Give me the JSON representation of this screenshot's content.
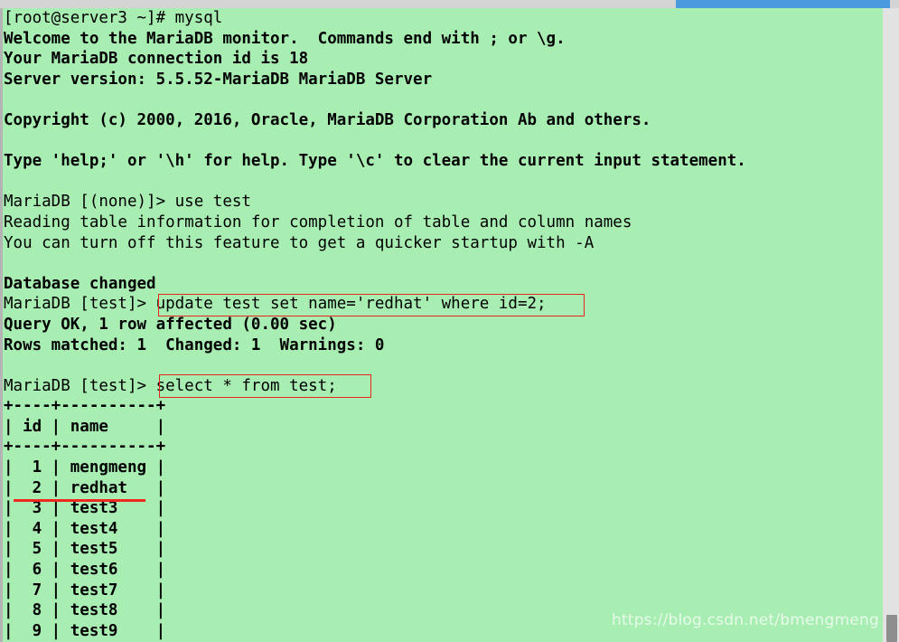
{
  "window": {
    "title": "MariaDB monitor session",
    "background_color": "#a8eeb2",
    "text_color": "#000000",
    "annotation_color": "#e8241b"
  },
  "scrollbars": {
    "horizontal": {
      "name": "horizontal-scrollbar",
      "track_color": "#d4d4d4",
      "thumb_color": "#4a9ade"
    },
    "vertical": {
      "name": "vertical-scrollbar",
      "track_color": "#e2e2e2",
      "thumb_color": "#8d8d8d"
    }
  },
  "terminal": {
    "lines": [
      {
        "text": "[root@server3 ~]# mysql",
        "weight": "reg"
      },
      {
        "text": "Welcome to the MariaDB monitor.  Commands end with ; or \\g.",
        "weight": "bold"
      },
      {
        "text": "Your MariaDB connection id is 18",
        "weight": "bold"
      },
      {
        "text": "Server version: 5.5.52-MariaDB MariaDB Server",
        "weight": "bold"
      },
      {
        "text": "",
        "weight": "blank"
      },
      {
        "text": "Copyright (c) 2000, 2016, Oracle, MariaDB Corporation Ab and others.",
        "weight": "bold"
      },
      {
        "text": "",
        "weight": "blank"
      },
      {
        "text": "Type 'help;' or '\\h' for help. Type '\\c' to clear the current input statement.",
        "weight": "bold"
      },
      {
        "text": "",
        "weight": "blank"
      },
      {
        "text": "MariaDB [(none)]> use test",
        "weight": "reg"
      },
      {
        "text": "Reading table information for completion of table and column names",
        "weight": "reg"
      },
      {
        "text": "You can turn off this feature to get a quicker startup with -A",
        "weight": "reg"
      },
      {
        "text": "",
        "weight": "blank"
      },
      {
        "text": "Database changed",
        "weight": "bold"
      },
      {
        "text": "MariaDB [test]> update test set name='redhat' where id=2;",
        "weight": "reg"
      },
      {
        "text": "Query OK, 1 row affected (0.00 sec)",
        "weight": "bold"
      },
      {
        "text": "Rows matched: 1  Changed: 1  Warnings: 0",
        "weight": "bold"
      },
      {
        "text": "",
        "weight": "blank"
      },
      {
        "text": "MariaDB [test]> select * from test;",
        "weight": "reg"
      },
      {
        "text": "+----+----------+",
        "weight": "bold"
      },
      {
        "text": "| id | name     |",
        "weight": "bold"
      },
      {
        "text": "+----+----------+",
        "weight": "bold"
      },
      {
        "text": "|  1 | mengmeng |",
        "weight": "bold"
      },
      {
        "text": "|  2 | redhat   |",
        "weight": "bold"
      },
      {
        "text": "|  3 | test3    |",
        "weight": "bold"
      },
      {
        "text": "|  4 | test4    |",
        "weight": "bold"
      },
      {
        "text": "|  5 | test5    |",
        "weight": "bold"
      },
      {
        "text": "|  6 | test6    |",
        "weight": "bold"
      },
      {
        "text": "|  7 | test7    |",
        "weight": "bold"
      },
      {
        "text": "|  8 | test8    |",
        "weight": "bold"
      },
      {
        "text": "|  9 | test9    |",
        "weight": "bold"
      }
    ],
    "commands_highlighted": [
      "update test set name='redhat' where id=2;",
      "select * from test;"
    ],
    "result_table": {
      "columns": [
        "id",
        "name"
      ],
      "rows": [
        [
          "1",
          "mengmeng"
        ],
        [
          "2",
          "redhat"
        ],
        [
          "3",
          "test3"
        ],
        [
          "4",
          "test4"
        ],
        [
          "5",
          "test5"
        ],
        [
          "6",
          "test6"
        ],
        [
          "7",
          "test7"
        ],
        [
          "8",
          "test8"
        ],
        [
          "9",
          "test9"
        ]
      ],
      "highlighted_row": [
        "2",
        "redhat"
      ]
    },
    "session": {
      "shell_prompt": "[root@server3 ~]#",
      "launch_command": "mysql",
      "connection_id": "18",
      "server_version": "5.5.52-MariaDB MariaDB Server",
      "database": "test",
      "rows_affected": "1",
      "query_time": "0.00 sec"
    }
  },
  "watermark": {
    "text": "https://blog.csdn.net/bmengmeng"
  }
}
